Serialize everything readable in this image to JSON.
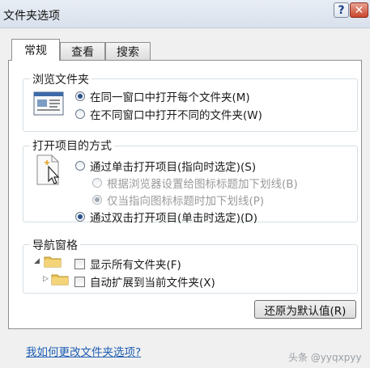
{
  "window": {
    "title": "文件夹选项"
  },
  "tabs": [
    {
      "label": "常规",
      "active": true
    },
    {
      "label": "查看",
      "active": false
    },
    {
      "label": "搜索",
      "active": false
    }
  ],
  "browse_group": {
    "title": "浏览文件夹",
    "options": [
      {
        "label": "在同一窗口中打开每个文件夹(M)",
        "checked": true,
        "disabled": false
      },
      {
        "label": "在不同窗口中打开不同的文件夹(W)",
        "checked": false,
        "disabled": false
      }
    ]
  },
  "click_group": {
    "title": "打开项目的方式",
    "options": [
      {
        "label": "通过单击打开项目(指向时选定)(S)",
        "checked": false,
        "disabled": false
      },
      {
        "label": "根据浏览器设置给图标标题加下划线(B)",
        "checked": false,
        "disabled": true
      },
      {
        "label": "仅当指向图标标题时加下划线(P)",
        "checked": true,
        "disabled": true
      },
      {
        "label": "通过双击打开项目(单击时选定)(D)",
        "checked": true,
        "disabled": false
      }
    ]
  },
  "nav_group": {
    "title": "导航窗格",
    "options": [
      {
        "label": "显示所有文件夹(F)",
        "checked": false
      },
      {
        "label": "自动扩展到当前文件夹(X)",
        "checked": false
      }
    ]
  },
  "restore_button": {
    "label": "还原为默认值(R)"
  },
  "help_link": {
    "label": "我如何更改文件夹选项?"
  },
  "watermark": {
    "text": "头条 @yyqxpyy"
  },
  "colors": {
    "link": "#1f5fb4",
    "close_button": "#c9462c",
    "accent": "#2a4f8a"
  }
}
